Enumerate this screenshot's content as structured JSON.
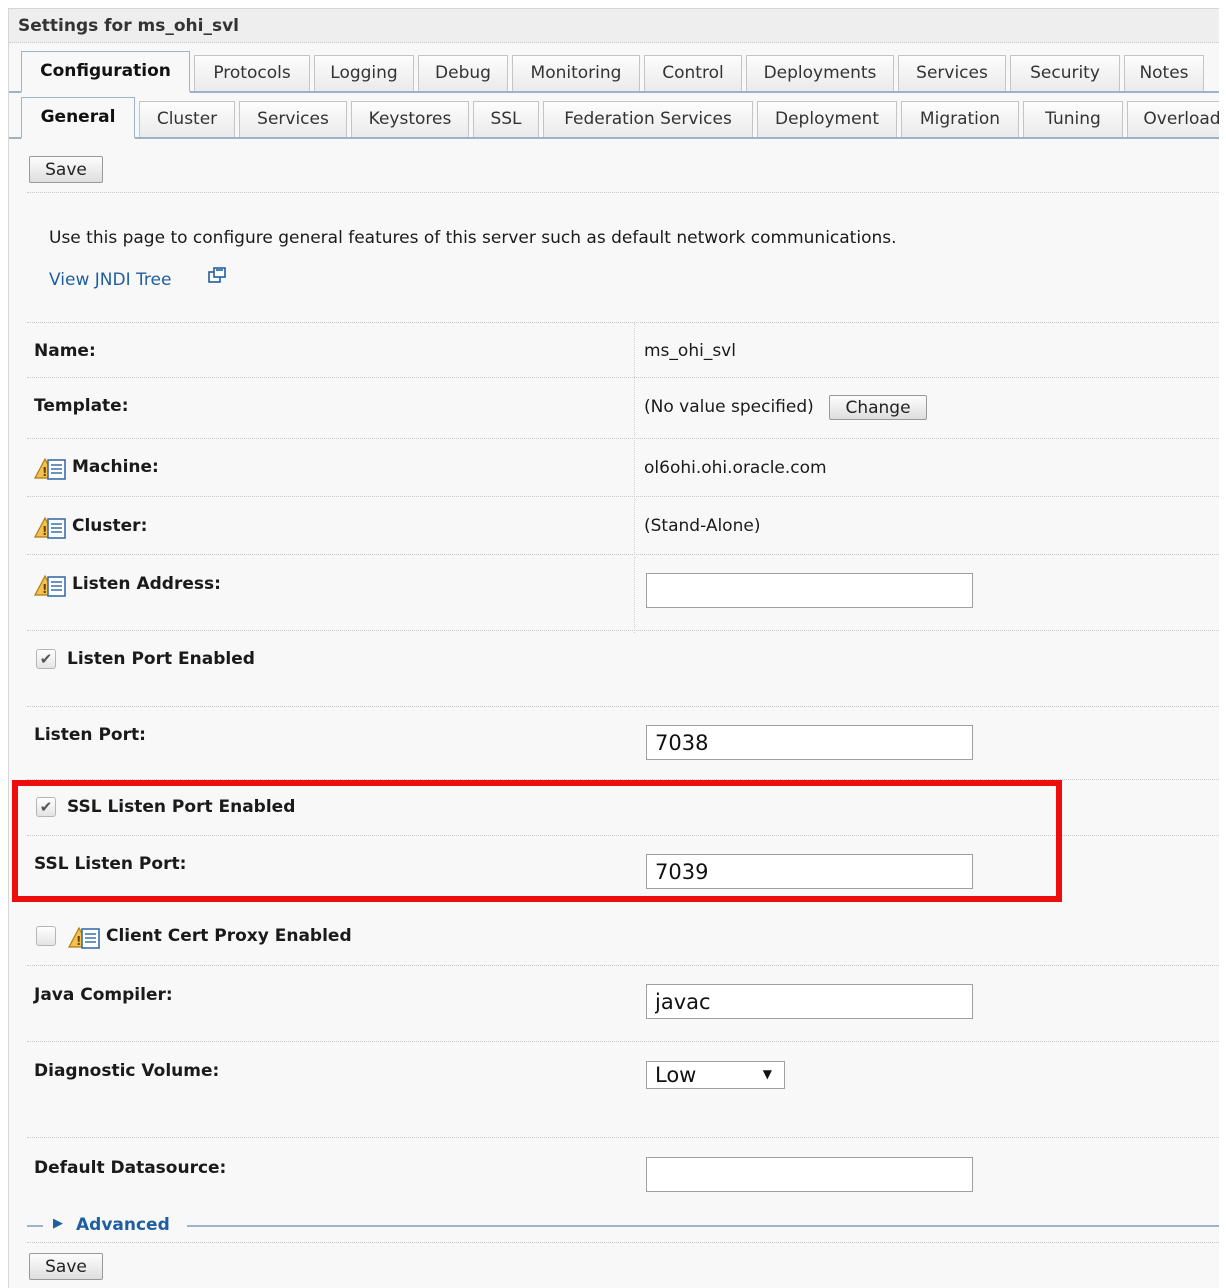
{
  "title": "Settings for ms_ohi_svl",
  "tabs_primary": [
    "Configuration",
    "Protocols",
    "Logging",
    "Debug",
    "Monitoring",
    "Control",
    "Deployments",
    "Services",
    "Security",
    "Notes"
  ],
  "tabs_secondary": [
    "General",
    "Cluster",
    "Services",
    "Keystores",
    "SSL",
    "Federation Services",
    "Deployment",
    "Migration",
    "Tuning",
    "Overload"
  ],
  "active_primary": "Configuration",
  "active_secondary": "General",
  "save_label": "Save",
  "description": "Use this page to configure general features of this server such as default network communications.",
  "jndi_link": "View JNDI Tree",
  "fields": {
    "name": {
      "label": "Name:",
      "value": "ms_ohi_svl"
    },
    "template": {
      "label": "Template:",
      "value": "(No value specified)",
      "button": "Change"
    },
    "machine": {
      "label": "Machine:",
      "value": "ol6ohi.ohi.oracle.com"
    },
    "cluster": {
      "label": "Cluster:",
      "value": "(Stand-Alone)"
    },
    "listen_address": {
      "label": "Listen Address:",
      "value": ""
    },
    "listen_port_enabled": {
      "label": "Listen Port Enabled",
      "checked": true
    },
    "listen_port": {
      "label": "Listen Port:",
      "value": "7038"
    },
    "ssl_listen_port_enabled": {
      "label": "SSL Listen Port Enabled",
      "checked": true
    },
    "ssl_listen_port": {
      "label": "SSL Listen Port:",
      "value": "7039"
    },
    "client_cert_proxy_enabled": {
      "label": "Client Cert Proxy Enabled",
      "checked": false
    },
    "java_compiler": {
      "label": "Java Compiler:",
      "value": "javac"
    },
    "diagnostic_volume": {
      "label": "Diagnostic Volume:",
      "value": "Low"
    },
    "default_datasource": {
      "label": "Default Datasource:",
      "value": ""
    }
  },
  "advanced_label": "Advanced",
  "colors": {
    "highlight": "#ee0d0d",
    "link": "#1f5fa0",
    "tab_border": "#9fb3c8"
  },
  "icons": {
    "change_requires_restart": "info-warning-icon",
    "external_link": "external-link-icon",
    "checkmark": "checkmark-icon",
    "expand_arrow": "triangle-right-icon"
  }
}
